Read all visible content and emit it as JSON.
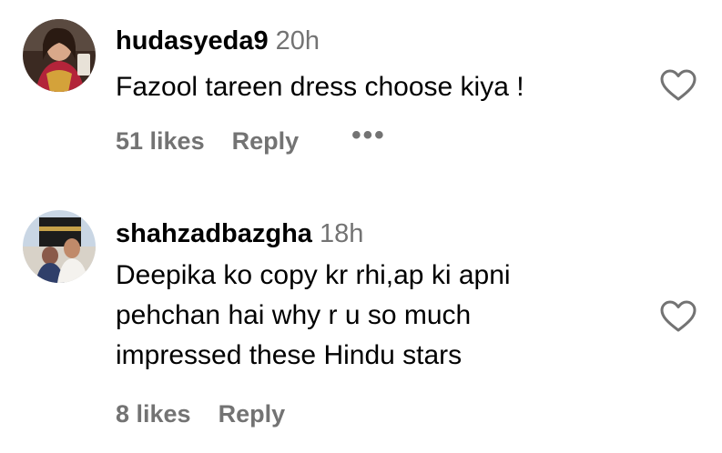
{
  "comments": [
    {
      "username": "hudasyeda9",
      "time": "20h",
      "text_lines": [
        "Fazool tareen dress choose kiya !"
      ],
      "likes": "51 likes",
      "reply_label": "Reply",
      "more_label": "•••"
    },
    {
      "username": "shahzadbazgha",
      "time": "18h",
      "text_lines": [
        "Deepika ko copy kr rhi,ap ki apni",
        "pehchan hai why r u so much",
        "impressed these Hindu stars"
      ],
      "likes": "8 likes",
      "reply_label": "Reply"
    }
  ],
  "icons": {
    "like": "heart-outline-icon",
    "more": "more-options-icon"
  },
  "colors": {
    "text": "#000000",
    "secondary": "#737373",
    "background": "#ffffff"
  }
}
